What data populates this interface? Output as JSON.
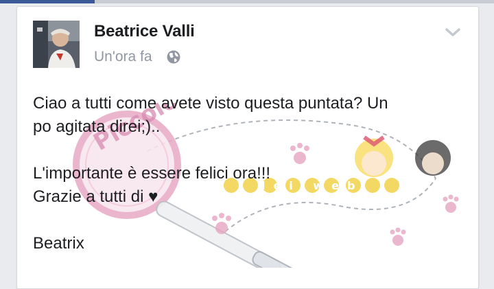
{
  "post": {
    "author": "Beatrice Valli",
    "timestamp": "Un'ora fa",
    "audience_icon": "globe-icon",
    "options_icon": "chevron-down-icon",
    "text_lines": [
      "Ciao a tutti come avete visto questa puntata? Un",
      "po agitata direi;)..",
      "L'importante è essere felici ora!!!",
      "Grazie a tutti di ♥",
      "Beatrix"
    ]
  },
  "watermark": {
    "script_text": "Piccolo Lolita",
    "tagline": "dei web"
  },
  "colors": {
    "text": "#1c1e21",
    "meta": "#9197a3",
    "brand_blue": "#3b5998",
    "watermark_pink": "#d88bb0",
    "watermark_yellow": "#f2d24a"
  }
}
